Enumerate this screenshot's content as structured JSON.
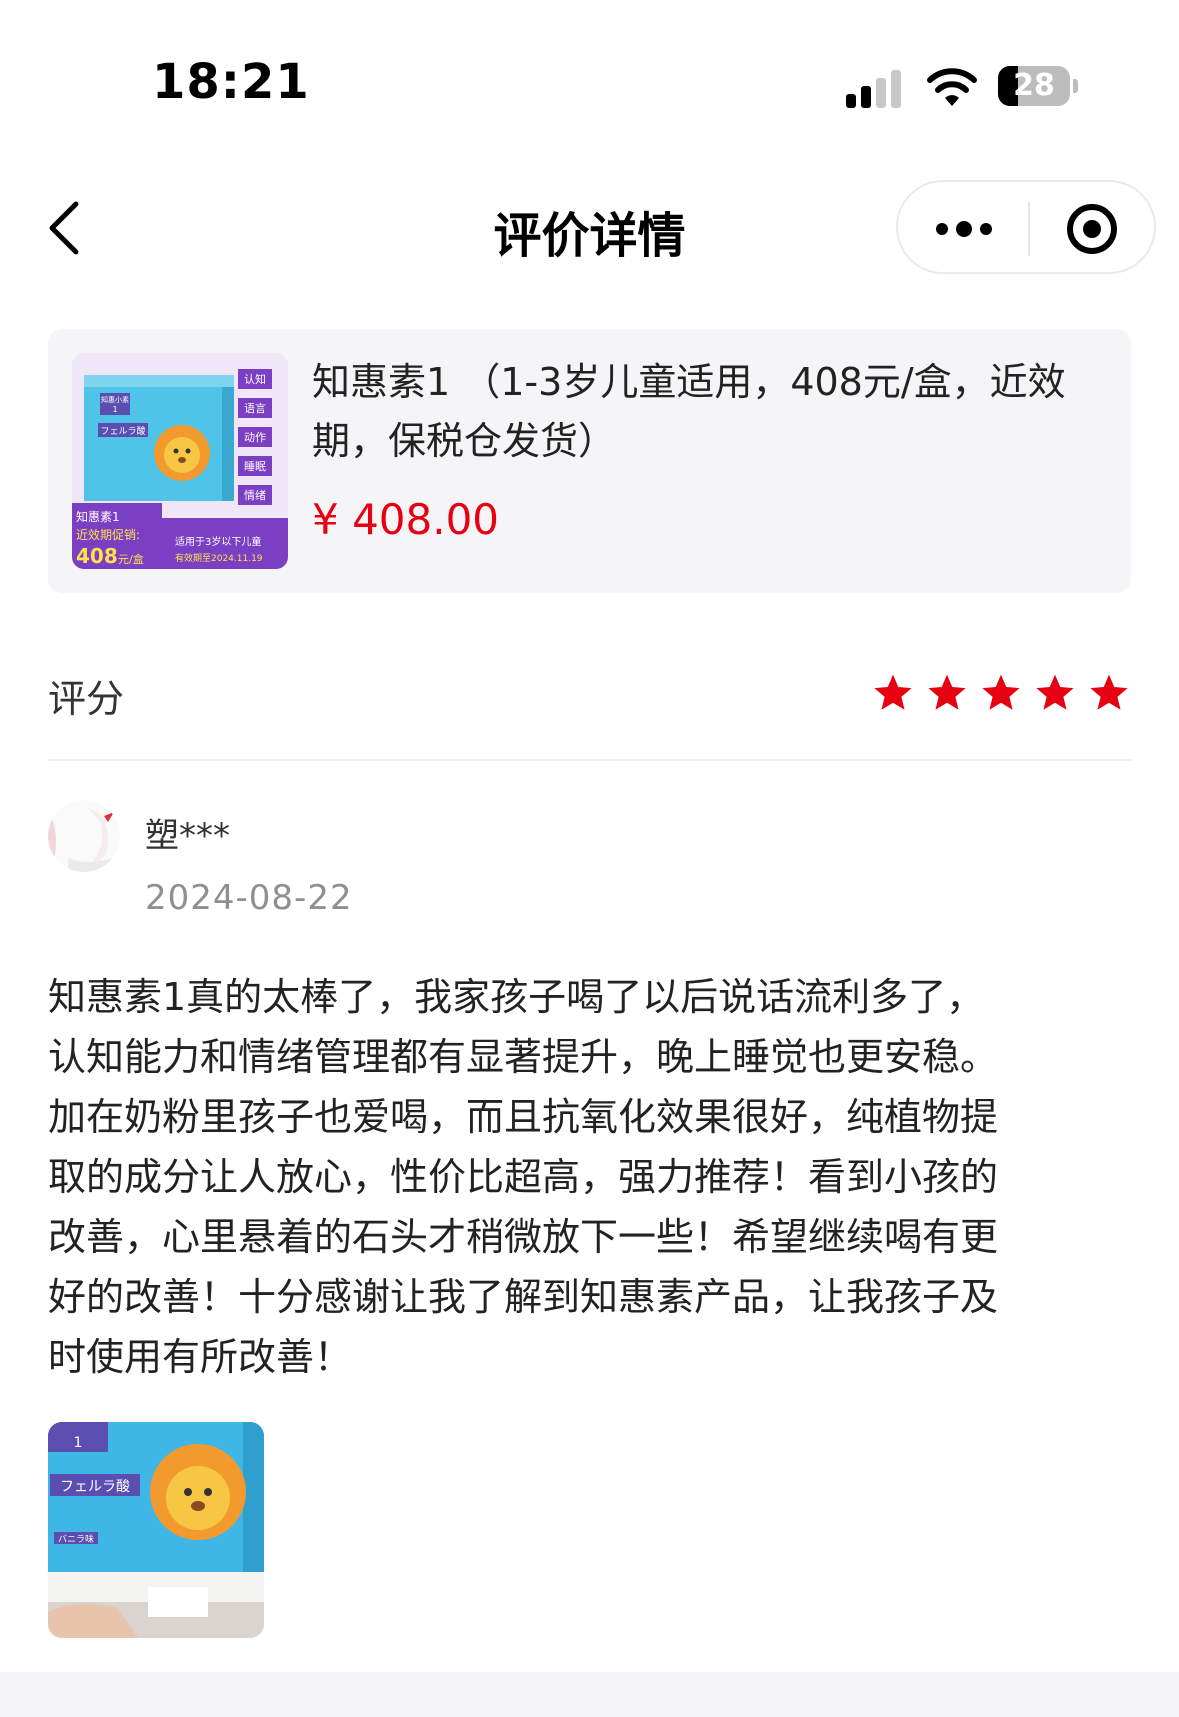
{
  "status_bar": {
    "time": "18:21",
    "battery_level": "28",
    "battery_fraction": 0.28,
    "icons": [
      "cellular-signal-icon",
      "wifi-icon",
      "battery-icon"
    ]
  },
  "nav": {
    "title": "评价详情",
    "back_icon": "chevron-left-icon",
    "more_icon": "more-dots-icon",
    "close_icon": "target-circle-icon"
  },
  "product": {
    "name": "知惠素1 （1-3岁儿童适用，408元/盒，近效期，保税仓发货）",
    "price": "¥ 408.00",
    "image": {
      "brand": "知惠小素",
      "number": "1",
      "product_label": "フェルラ酸",
      "tags": [
        "认知",
        "语言",
        "动作",
        "睡眠",
        "情绪"
      ],
      "promo_title": "知惠素1",
      "promo_line": "近效期促销:",
      "promo_price": "408",
      "promo_unit": "元/盒",
      "note_line1": "适用于3岁以下儿童",
      "note_line2": "有效期至2024.11.19"
    }
  },
  "rating": {
    "label": "评分",
    "stars": 5,
    "max_stars": 5,
    "star_color": "#e60012"
  },
  "review": {
    "user": "塑***",
    "date": "2024-08-22",
    "text": "知惠素1真的太棒了，我家孩子喝了以后说话流利多了，\n认知能力和情绪管理都有显著提升，晚上睡觉也更安稳。\n加在奶粉里孩子也爱喝，而且抗氧化效果很好，纯植物提\n取的成分让人放心，性价比超高，强力推荐！看到小孩的\n改善，心里悬着的石头才稍微放下一些！希望继续喝有更\n好的改善！十分感谢让我了解到知惠素产品，让我孩子及\n时使用有所改善！",
    "photo": {
      "number": "1",
      "product_label": "フェルラ酸",
      "flavor": "バニラ味"
    }
  },
  "colors": {
    "price_red": "#e60012",
    "card_bg": "#f5f5f7",
    "box_cyan": "#4fc3e8",
    "promo_purple": "#7b3fc4"
  }
}
